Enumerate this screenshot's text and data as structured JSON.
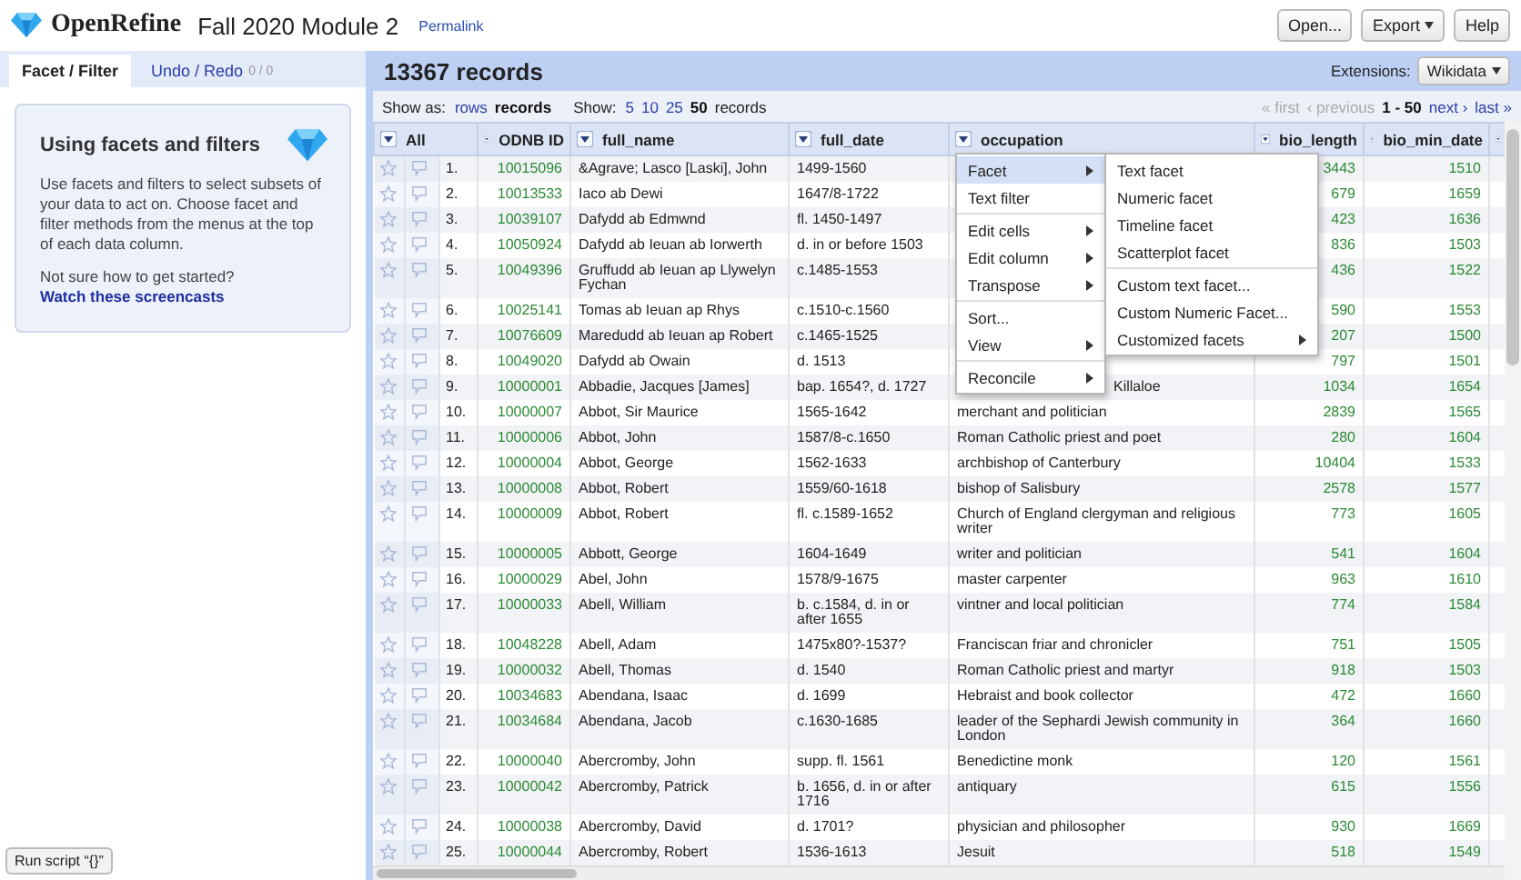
{
  "app": {
    "name": "OpenRefine",
    "project": "Fall 2020 Module 2",
    "permalink": "Permalink"
  },
  "top_buttons": [
    {
      "label": "Open...",
      "caret": false
    },
    {
      "label": "Export",
      "caret": true
    },
    {
      "label": "Help",
      "caret": false
    }
  ],
  "left_tabs": [
    {
      "label": "Facet / Filter",
      "selected": true
    },
    {
      "label": "Undo / Redo",
      "count": "0 / 0",
      "selected": false
    }
  ],
  "help_card": {
    "title": "Using facets and filters",
    "body": "Use facets and filters to select subsets of your data to act on. Choose facet and filter methods from the menus at the top of each data column.",
    "question": "Not sure how to get started?",
    "link": "Watch these screencasts"
  },
  "run_script": "Run script “{}”",
  "grid": {
    "title": "13367 records",
    "extensions_label": "Extensions:",
    "extensions_value": "Wikidata",
    "show_as": {
      "label": "Show as:",
      "options": [
        {
          "label": "rows",
          "selected": false
        },
        {
          "label": "records",
          "selected": true
        }
      ]
    },
    "show": {
      "label": "Show:",
      "options": [
        {
          "label": "5",
          "selected": false
        },
        {
          "label": "10",
          "selected": false
        },
        {
          "label": "25",
          "selected": false
        },
        {
          "label": "50",
          "selected": true
        }
      ],
      "suffix": "records"
    },
    "pager": [
      {
        "label": "« first",
        "kind": "link",
        "disabled": true
      },
      {
        "label": "‹ previous",
        "kind": "link",
        "disabled": true
      },
      {
        "label": "1 - 50",
        "kind": "range",
        "disabled": false
      },
      {
        "label": "next ›",
        "kind": "link",
        "disabled": false
      },
      {
        "label": "last »",
        "kind": "link",
        "disabled": false
      }
    ],
    "all_label": "All",
    "columns": [
      {
        "label": "ODNB ID",
        "kind": "id"
      },
      {
        "label": "full_name",
        "kind": "text"
      },
      {
        "label": "full_date",
        "kind": "text"
      },
      {
        "label": "occupation",
        "kind": "text"
      },
      {
        "label": "bio_length",
        "kind": "number"
      },
      {
        "label": "bio_min_date",
        "kind": "number"
      },
      {
        "kind": "cut"
      }
    ],
    "rows": [
      {
        "n": "1.",
        "cells": [
          "10015096",
          "&Agrave; Lasco [Laski], John",
          "1499-1560",
          "",
          "3443",
          "1510"
        ]
      },
      {
        "n": "2.",
        "cells": [
          "10013533",
          "Iaco ab Dewi",
          "1647/8-1722",
          "",
          "679",
          "1659"
        ]
      },
      {
        "n": "3.",
        "cells": [
          "10039107",
          "Dafydd ab Edmwnd",
          "fl. 1450-1497",
          "",
          "423",
          "1636"
        ]
      },
      {
        "n": "4.",
        "cells": [
          "10050924",
          "Dafydd ab Ieuan ab Iorwerth",
          "d. in or before 1503",
          "",
          "836",
          "1503"
        ]
      },
      {
        "n": "5.",
        "cells": [
          "10049396",
          "Gruffudd ab Ieuan ap Llywelyn Fychan",
          "c.1485-1553",
          "",
          "436",
          "1522"
        ]
      },
      {
        "n": "6.",
        "cells": [
          "10025141",
          "Tomas ab Ieuan ap Rhys",
          "c.1510-c.1560",
          "",
          "590",
          "1553"
        ]
      },
      {
        "n": "7.",
        "cells": [
          "10076609",
          "Maredudd ab Ieuan ap Robert",
          "c.1465-1525",
          "",
          "207",
          "1500"
        ]
      },
      {
        "n": "8.",
        "cells": [
          "10049020",
          "Dafydd ab Owain",
          "d. 1513",
          "",
          "797",
          "1501"
        ]
      },
      {
        "n": "9.",
        "cells": [
          "10000001",
          "Abbadie, Jacques [James]",
          "bap. 1654?, d. 1727",
          "Killaloe",
          "1034",
          "1654"
        ],
        "occupation_clipped": true
      },
      {
        "n": "10.",
        "cells": [
          "10000007",
          "Abbot, Sir Maurice",
          "1565-1642",
          "merchant and politician",
          "2839",
          "1565"
        ]
      },
      {
        "n": "11.",
        "cells": [
          "10000006",
          "Abbot, John",
          "1587/8-c.1650",
          "Roman Catholic priest and poet",
          "280",
          "1604"
        ]
      },
      {
        "n": "12.",
        "cells": [
          "10000004",
          "Abbot, George",
          "1562-1633",
          "archbishop of Canterbury",
          "10404",
          "1533"
        ]
      },
      {
        "n": "13.",
        "cells": [
          "10000008",
          "Abbot, Robert",
          "1559/60-1618",
          "bishop of Salisbury",
          "2578",
          "1577"
        ]
      },
      {
        "n": "14.",
        "cells": [
          "10000009",
          "Abbot, Robert",
          "fl. c.1589-1652",
          "Church of England clergyman and religious writer",
          "773",
          "1605"
        ]
      },
      {
        "n": "15.",
        "cells": [
          "10000005",
          "Abbott, George",
          "1604-1649",
          "writer and politician",
          "541",
          "1604"
        ]
      },
      {
        "n": "16.",
        "cells": [
          "10000029",
          "Abel, John",
          "1578/9-1675",
          "master carpenter",
          "963",
          "1610"
        ]
      },
      {
        "n": "17.",
        "cells": [
          "10000033",
          "Abell, William",
          "b. c.1584, d. in or after 1655",
          "vintner and local politician",
          "774",
          "1584"
        ]
      },
      {
        "n": "18.",
        "cells": [
          "10048228",
          "Abell, Adam",
          "1475x80?-1537?",
          "Franciscan friar and chronicler",
          "751",
          "1505"
        ]
      },
      {
        "n": "19.",
        "cells": [
          "10000032",
          "Abell, Thomas",
          "d. 1540",
          "Roman Catholic priest and martyr",
          "918",
          "1503"
        ]
      },
      {
        "n": "20.",
        "cells": [
          "10034683",
          "Abendana, Isaac",
          "d. 1699",
          "Hebraist and book collector",
          "472",
          "1660"
        ]
      },
      {
        "n": "21.",
        "cells": [
          "10034684",
          "Abendana, Jacob",
          "c.1630-1685",
          "leader of the Sephardi Jewish community in London",
          "364",
          "1660"
        ]
      },
      {
        "n": "22.",
        "cells": [
          "10000040",
          "Abercromby, John",
          "supp. fl. 1561",
          "Benedictine monk",
          "120",
          "1561"
        ]
      },
      {
        "n": "23.",
        "cells": [
          "10000042",
          "Abercromby, Patrick",
          "b. 1656, d. in or after 1716",
          "antiquary",
          "615",
          "1556"
        ]
      },
      {
        "n": "24.",
        "cells": [
          "10000038",
          "Abercromby, David",
          "d. 1701?",
          "physician and philosopher",
          "930",
          "1669"
        ]
      },
      {
        "n": "25.",
        "cells": [
          "10000044",
          "Abercromby, Robert",
          "1536-1613",
          "Jesuit",
          "518",
          "1549"
        ]
      }
    ]
  },
  "column_menu": {
    "groups": [
      [
        {
          "label": "Facet",
          "submenu": true,
          "highlighted": true
        },
        {
          "label": "Text filter",
          "submenu": false,
          "highlighted": false
        }
      ],
      [
        {
          "label": "Edit cells",
          "submenu": true,
          "highlighted": false
        },
        {
          "label": "Edit column",
          "submenu": true,
          "highlighted": false
        },
        {
          "label": "Transpose",
          "submenu": true,
          "highlighted": false
        }
      ],
      [
        {
          "label": "Sort...",
          "submenu": false,
          "highlighted": false
        },
        {
          "label": "View",
          "submenu": true,
          "highlighted": false
        }
      ],
      [
        {
          "label": "Reconcile",
          "submenu": true,
          "highlighted": false
        }
      ]
    ]
  },
  "facet_submenu": {
    "groups": [
      [
        {
          "label": "Text facet",
          "submenu": false
        },
        {
          "label": "Numeric facet",
          "submenu": false
        },
        {
          "label": "Timeline facet",
          "submenu": false
        },
        {
          "label": "Scatterplot facet",
          "submenu": false
        }
      ],
      [
        {
          "label": "Custom text facet...",
          "submenu": false
        },
        {
          "label": "Custom Numeric Facet...",
          "submenu": false
        },
        {
          "label": "Customized facets",
          "submenu": true
        }
      ]
    ]
  }
}
